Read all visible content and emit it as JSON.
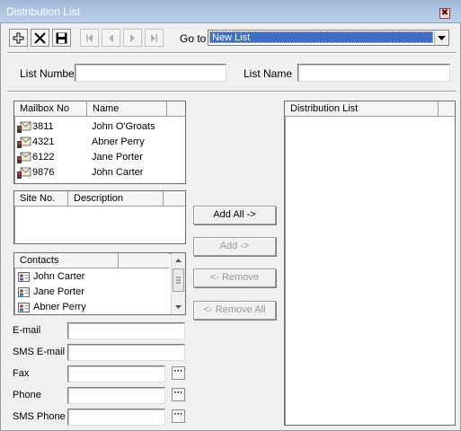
{
  "window": {
    "title": "Distribution List",
    "close_glyph": "✖"
  },
  "toolbar": {
    "buttons": [
      {
        "name": "add-icon",
        "enabled": true
      },
      {
        "name": "delete-icon",
        "enabled": true
      },
      {
        "name": "save-icon",
        "enabled": true
      },
      {
        "name": "first-record-icon",
        "enabled": false
      },
      {
        "name": "previous-record-icon",
        "enabled": false
      },
      {
        "name": "next-record-icon",
        "enabled": false
      },
      {
        "name": "last-record-icon",
        "enabled": false
      }
    ],
    "goto_label": "Go to",
    "goto_value": "New List"
  },
  "form": {
    "list_number_label": "List Number",
    "list_number_value": "",
    "list_name_label": "List Name",
    "list_name_value": ""
  },
  "mailbox_list": {
    "headers": [
      "Mailbox No",
      "Name"
    ],
    "rows": [
      {
        "number": "3811",
        "name": "John O'Groats"
      },
      {
        "number": "4321",
        "name": "Abner Perry"
      },
      {
        "number": "6122",
        "name": "Jane Porter"
      },
      {
        "number": "9876",
        "name": "John Carter"
      }
    ]
  },
  "site_list": {
    "headers": [
      "Site No.",
      "Description"
    ],
    "rows": []
  },
  "contacts_list": {
    "headers": [
      "Contacts"
    ],
    "rows": [
      "John Carter",
      "Jane Porter",
      "Abner Perry"
    ]
  },
  "distribution_list": {
    "headers": [
      "Distribution List"
    ],
    "rows": []
  },
  "actions": {
    "add_all": "Add All ->",
    "add": "Add ->",
    "remove": "<- Remove",
    "remove_all": "<- Remove All"
  },
  "contact_fields": [
    {
      "label": "E-mail",
      "value": "",
      "has_picker": false
    },
    {
      "label": "SMS E-mail",
      "value": "",
      "has_picker": false
    },
    {
      "label": "Fax",
      "value": "",
      "has_picker": true
    },
    {
      "label": "Phone",
      "value": "",
      "has_picker": true
    },
    {
      "label": "SMS Phone",
      "value": "",
      "has_picker": true
    }
  ],
  "picker_glyph": "···",
  "colors": {
    "selection": "#3e6fc5",
    "titlebar": "#abc2e0"
  }
}
